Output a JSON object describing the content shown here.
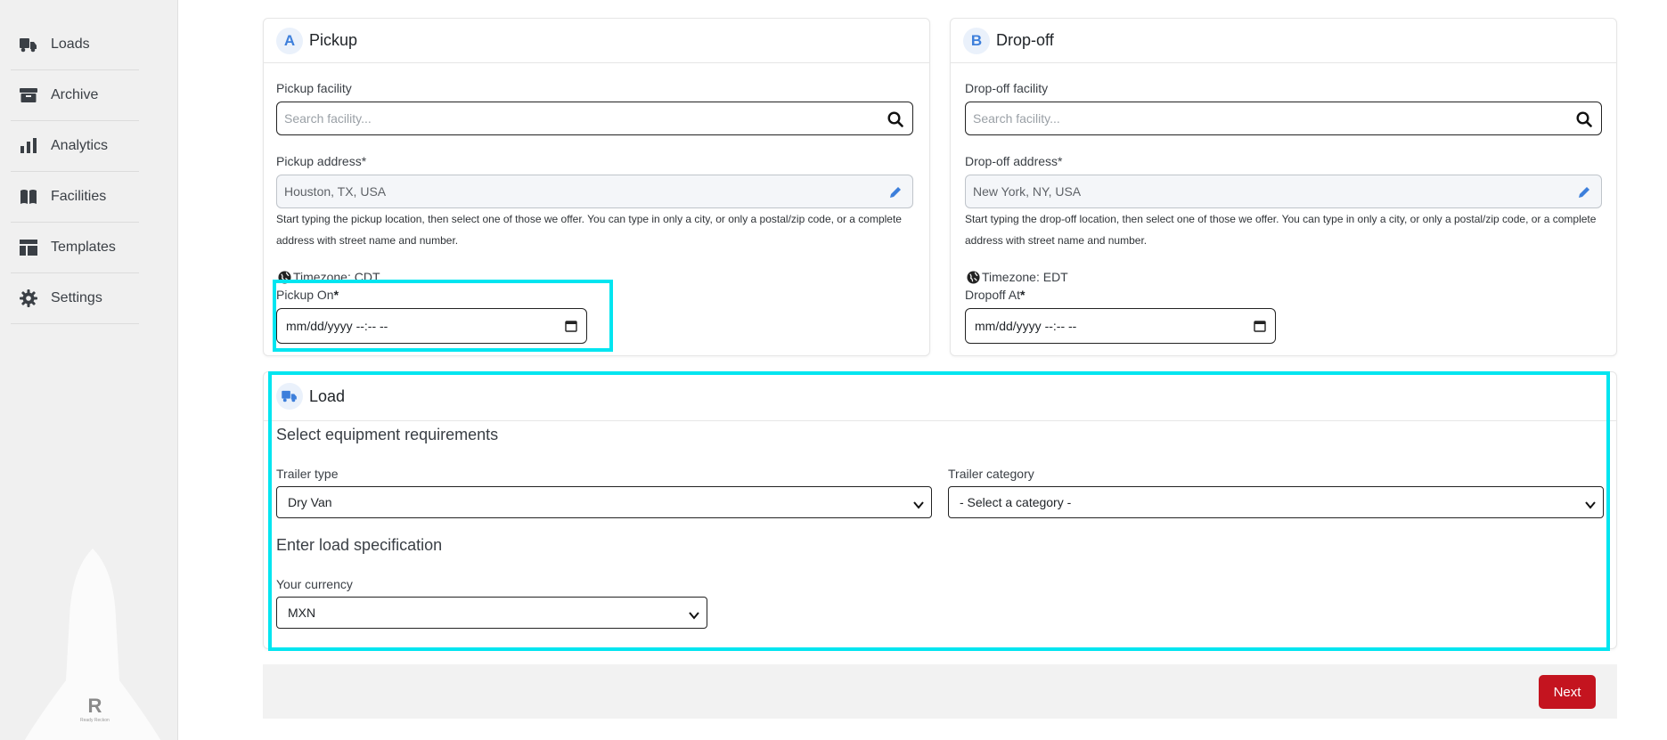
{
  "sidebar": {
    "items": [
      {
        "label": "Loads",
        "icon": "truck-icon"
      },
      {
        "label": "Archive",
        "icon": "archive-box-icon"
      },
      {
        "label": "Analytics",
        "icon": "bar-chart-icon"
      },
      {
        "label": "Facilities",
        "icon": "book-icon"
      },
      {
        "label": "Templates",
        "icon": "layout-icon"
      },
      {
        "label": "Settings",
        "icon": "gear-icon"
      }
    ],
    "brand": {
      "mark": "R",
      "text": "Ready Reckon"
    }
  },
  "pickup": {
    "badge": "A",
    "title": "Pickup",
    "facility_label": "Pickup facility",
    "facility_placeholder": "Search facility...",
    "address_label": "Pickup address",
    "address_required": "*",
    "address_value": "Houston, TX, USA",
    "help_line1": "Start typing the pickup location, then select one of those we offer. You can type in only a city, or only a postal/zip code, or a complete",
    "help_line2": "address with street name and number.",
    "timezone": "Timezone: CDT",
    "date_label": "Pickup On",
    "date_required": "*",
    "date_placeholder": "mm/dd/yyyy --:-- --"
  },
  "dropoff": {
    "badge": "B",
    "title": "Drop-off",
    "facility_label": "Drop-off facility",
    "facility_placeholder": "Search facility...",
    "address_label": "Drop-off address",
    "address_required": "*",
    "address_value": "New York, NY, USA",
    "help_line1": "Start typing the drop-off location, then select one of those we offer. You can type in only a city, or only a postal/zip code, or a complete",
    "help_line2": "address with street name and number.",
    "timezone": "Timezone: EDT",
    "date_label": "Dropoff At",
    "date_required": "*",
    "date_placeholder": "mm/dd/yyyy --:-- --"
  },
  "load": {
    "title": "Load",
    "equipment_heading": "Select equipment requirements",
    "trailer_type_label": "Trailer type",
    "trailer_type_value": "Dry Van",
    "trailer_category_label": "Trailer category",
    "trailer_category_value": "- Select a category -",
    "spec_heading": "Enter load specification",
    "currency_label": "Your currency",
    "currency_value": "MXN"
  },
  "footer": {
    "next_label": "Next"
  },
  "colors": {
    "accent": "#3d7fdb",
    "highlight": "#00e5f0",
    "next_button": "#c4141f"
  }
}
